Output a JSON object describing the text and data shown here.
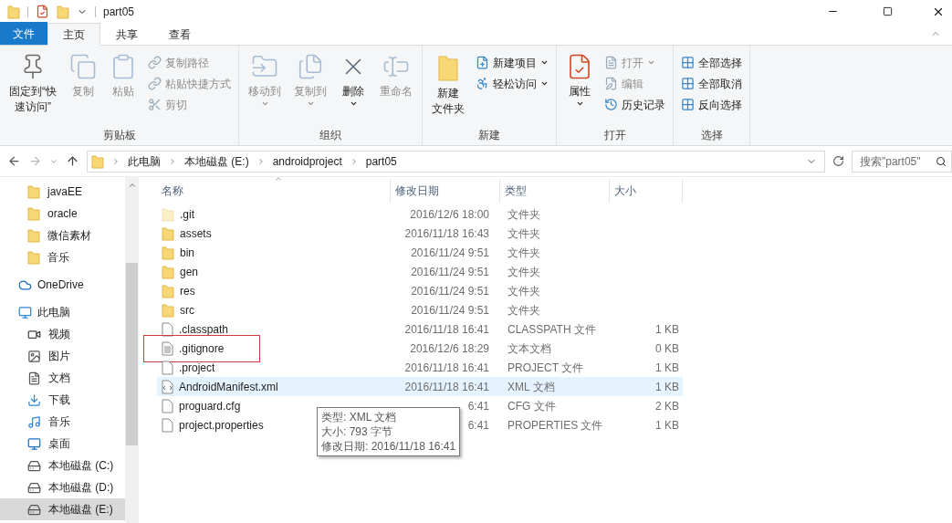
{
  "window": {
    "title": "part05"
  },
  "ribbon_tabs": [
    {
      "label": "文件",
      "kind": "file",
      "selected": false
    },
    {
      "label": "主页",
      "kind": "tab",
      "selected": true
    },
    {
      "label": "共享",
      "kind": "tab",
      "selected": false
    },
    {
      "label": "查看",
      "kind": "tab",
      "selected": false
    }
  ],
  "ribbon_groups": [
    {
      "label": "剪贴板",
      "large": [
        {
          "lines": [
            "固定到“快",
            "速访问”"
          ],
          "disabled": false,
          "has_menu": false
        },
        {
          "lines": [
            "复制"
          ],
          "disabled": true,
          "has_menu": false
        },
        {
          "lines": [
            "粘贴"
          ],
          "disabled": true,
          "has_menu": false
        }
      ],
      "small": [
        {
          "label": "复制路径",
          "disabled": true,
          "has_menu": false
        },
        {
          "label": "粘贴快捷方式",
          "disabled": true,
          "has_menu": false
        },
        {
          "label": "剪切",
          "disabled": true,
          "has_menu": false
        }
      ]
    },
    {
      "label": "组织",
      "large": [
        {
          "lines": [
            "移动到"
          ],
          "disabled": true,
          "has_menu": true
        },
        {
          "lines": [
            "复制到"
          ],
          "disabled": true,
          "has_menu": true
        },
        {
          "lines": [
            "删除"
          ],
          "disabled": false,
          "has_menu": true
        },
        {
          "lines": [
            "重命名"
          ],
          "disabled": true,
          "has_menu": false
        }
      ]
    },
    {
      "label": "新建",
      "large": [
        {
          "lines": [
            "新建",
            "文件夹"
          ],
          "disabled": false,
          "has_menu": false
        }
      ],
      "small": [
        {
          "label": "新建项目",
          "disabled": false,
          "has_menu": true
        },
        {
          "label": "轻松访问",
          "disabled": false,
          "has_menu": true
        }
      ]
    },
    {
      "label": "打开",
      "large": [
        {
          "lines": [
            "属性"
          ],
          "disabled": false,
          "has_menu": true
        }
      ],
      "small": [
        {
          "label": "打开",
          "disabled": true,
          "has_menu": true
        },
        {
          "label": "编辑",
          "disabled": true,
          "has_menu": false
        },
        {
          "label": "历史记录",
          "disabled": false,
          "has_menu": false
        }
      ]
    },
    {
      "label": "选择",
      "small": [
        {
          "label": "全部选择",
          "disabled": false,
          "has_menu": false
        },
        {
          "label": "全部取消",
          "disabled": false,
          "has_menu": false
        },
        {
          "label": "反向选择",
          "disabled": false,
          "has_menu": false
        }
      ]
    }
  ],
  "breadcrumbs": [
    "此电脑",
    "本地磁盘 (E:)",
    "androidproject",
    "part05"
  ],
  "search": {
    "placeholder": "搜索\"part05\""
  },
  "quick_access_items": [
    {
      "label": "javaEE",
      "selected": false
    },
    {
      "label": "oracle",
      "selected": false
    },
    {
      "label": "微信素材",
      "selected": false
    },
    {
      "label": "音乐",
      "selected": false
    }
  ],
  "tree": [
    {
      "label": "OneDrive",
      "kind": "onedrive",
      "selected": false
    },
    {
      "label": "此电脑",
      "kind": "pc",
      "selected": false,
      "children": [
        {
          "label": "视频",
          "kind": "video",
          "selected": false
        },
        {
          "label": "图片",
          "kind": "pictures",
          "selected": false
        },
        {
          "label": "文档",
          "kind": "documents",
          "selected": false
        },
        {
          "label": "下载",
          "kind": "downloads",
          "selected": false
        },
        {
          "label": "音乐",
          "kind": "music",
          "selected": false
        },
        {
          "label": "桌面",
          "kind": "desktop",
          "selected": false
        },
        {
          "label": "本地磁盘 (C:)",
          "kind": "systemdrive",
          "selected": false
        },
        {
          "label": "本地磁盘 (D:)",
          "kind": "drive",
          "selected": false
        },
        {
          "label": "本地磁盘 (E:)",
          "kind": "drive",
          "selected": true
        }
      ]
    }
  ],
  "columns": [
    {
      "label": "名称",
      "sorted": true
    },
    {
      "label": "修改日期",
      "sorted": false
    },
    {
      "label": "类型",
      "sorted": false
    },
    {
      "label": "大小",
      "sorted": false
    }
  ],
  "files": [
    {
      "name": ".git",
      "kind": "folder",
      "hidden": true,
      "date": "2016/12/6 18:00",
      "type": "文件夹",
      "highlighted": false,
      "marked": false
    },
    {
      "name": "assets",
      "kind": "folder",
      "hidden": false,
      "date": "2016/11/18 16:43",
      "type": "文件夹",
      "highlighted": false,
      "marked": false
    },
    {
      "name": "bin",
      "kind": "folder",
      "hidden": false,
      "date": "2016/11/24 9:51",
      "type": "文件夹",
      "highlighted": false,
      "marked": false
    },
    {
      "name": "gen",
      "kind": "folder",
      "hidden": false,
      "date": "2016/11/24 9:51",
      "type": "文件夹",
      "highlighted": false,
      "marked": false
    },
    {
      "name": "res",
      "kind": "folder",
      "hidden": false,
      "date": "2016/11/24 9:51",
      "type": "文件夹",
      "highlighted": false,
      "marked": false
    },
    {
      "name": "src",
      "kind": "folder",
      "hidden": false,
      "date": "2016/11/24 9:51",
      "type": "文件夹",
      "highlighted": false,
      "marked": false
    },
    {
      "name": ".classpath",
      "kind": "file",
      "hidden": false,
      "date": "2016/11/18 16:41",
      "type": "CLASSPATH 文件",
      "size": "1 KB",
      "highlighted": false,
      "marked": false
    },
    {
      "name": ".gitignore",
      "kind": "text",
      "hidden": false,
      "date": "2016/12/6 18:29",
      "type": "文本文档",
      "size": "0 KB",
      "highlighted": false,
      "marked": true
    },
    {
      "name": ".project",
      "kind": "file",
      "hidden": false,
      "date": "2016/11/18 16:41",
      "type": "PROJECT 文件",
      "size": "1 KB",
      "highlighted": false,
      "marked": false
    },
    {
      "name": "AndroidManifest.xml",
      "kind": "xml",
      "hidden": false,
      "date": "2016/11/18 16:41",
      "type": "XML 文档",
      "size": "1 KB",
      "highlighted": true,
      "marked": false
    },
    {
      "name": "proguard.cfg",
      "kind": "file",
      "hidden": false,
      "date": "6:41",
      "type": "CFG 文件",
      "size": "2 KB",
      "highlighted": false,
      "marked": false
    },
    {
      "name": "project.properties",
      "kind": "file",
      "hidden": false,
      "date": "6:41",
      "type": "PROPERTIES 文件",
      "size": "1 KB",
      "highlighted": false,
      "marked": false
    }
  ],
  "tooltip": {
    "lines": [
      "类型: XML 文档",
      "大小: 793 字节",
      "修改日期: 2016/11/18 16:41"
    ]
  }
}
